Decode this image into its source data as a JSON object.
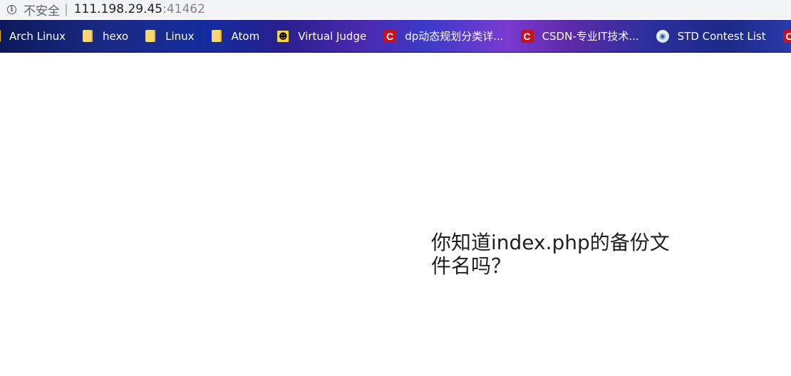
{
  "address_bar": {
    "security_label": "不安全",
    "separator": "|",
    "host": "111.198.29.45",
    "port": ":41462"
  },
  "bookmarks": [
    {
      "label": "Arch Linux",
      "icon": "folder-icon"
    },
    {
      "label": "hexo",
      "icon": "folder-icon"
    },
    {
      "label": "Linux",
      "icon": "folder-icon"
    },
    {
      "label": "Atom",
      "icon": "folder-icon"
    },
    {
      "label": "Virtual Judge",
      "icon": "virtual-judge-icon"
    },
    {
      "label": "dp动态规划分类详...",
      "icon": "csdn-icon"
    },
    {
      "label": "CSDN-专业IT技术...",
      "icon": "csdn-icon"
    },
    {
      "label": "STD Contest List",
      "icon": "std-icon"
    },
    {
      "label": "C",
      "icon": "csdn-icon"
    }
  ],
  "page": {
    "message": "你知道index.php的备份文件名吗？"
  },
  "colors": {
    "csdn_red": "#c8101e",
    "folder_yellow": "#f7d774",
    "bookmark_text": "#ffffff"
  }
}
